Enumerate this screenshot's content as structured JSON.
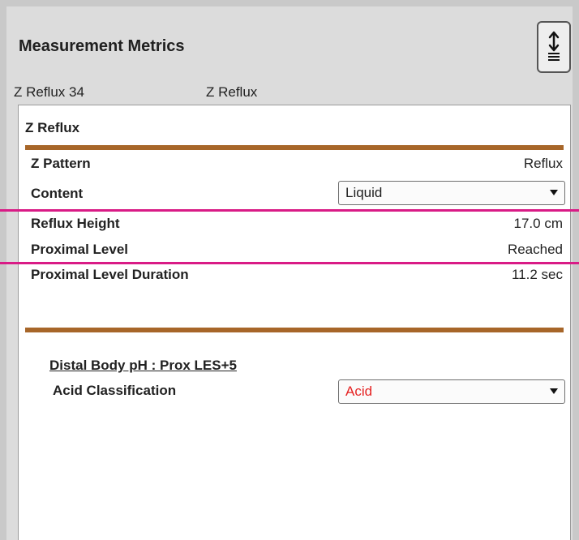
{
  "panel": {
    "title": "Measurement Metrics",
    "subheader_left": "Z Reflux 34",
    "subheader_right": "Z Reflux"
  },
  "section": {
    "title": "Z Reflux",
    "rows": [
      {
        "label": "Z Pattern",
        "value": "Reflux"
      },
      {
        "label": "Content",
        "value": "Liquid"
      },
      {
        "label": "Reflux Height",
        "value": "17.0 cm"
      },
      {
        "label": "Proximal Level",
        "value": "Reached"
      },
      {
        "label": "Proximal Level Duration",
        "value": "11.2 sec"
      }
    ]
  },
  "subsection": {
    "title": "Distal Body pH : Prox LES+5",
    "acid_label": "Acid Classification",
    "acid_value": "Acid"
  },
  "colors": {
    "rule": "#a76629",
    "highlight": "#d91b86",
    "acid_text": "#e52222"
  },
  "icons": {
    "collapse": "vertical-expand-icon"
  }
}
